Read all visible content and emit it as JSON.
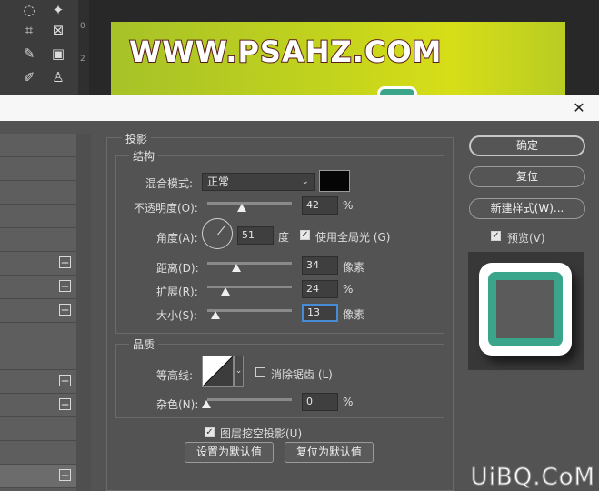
{
  "canvas": {
    "site_text": "WWW.PSAHZ.COM",
    "ruler_marks": [
      "0",
      "2"
    ]
  },
  "dialog": {
    "close_glyph": "✕",
    "section_title": "投影",
    "structure": {
      "title": "结构",
      "blend_mode_label": "混合模式:",
      "blend_mode_value": "正常",
      "shadow_color": "#050505",
      "opacity_label": "不透明度(O):",
      "opacity_value": "42",
      "opacity_unit": "%",
      "angle_label": "角度(A):",
      "angle_value": "51",
      "angle_unit": "度",
      "global_light_label": "使用全局光 (G)",
      "global_light_checked": true,
      "distance_label": "距离(D):",
      "distance_value": "34",
      "distance_unit": "像素",
      "spread_label": "扩展(R):",
      "spread_value": "24",
      "spread_unit": "%",
      "size_label": "大小(S):",
      "size_value": "13",
      "size_unit": "像素"
    },
    "quality": {
      "title": "品质",
      "contour_label": "等高线:",
      "anti_alias_label": "消除锯齿 (L)",
      "anti_alias_checked": false,
      "noise_label": "杂色(N):",
      "noise_value": "0",
      "noise_unit": "%"
    },
    "knockout_label": "图层挖空投影(U)",
    "knockout_checked": true,
    "set_default_label": "设置为默认值",
    "reset_default_label": "复位为默认值",
    "buttons": {
      "ok": "确定",
      "reset": "复位",
      "new_style": "新建样式(W)...",
      "preview_label": "预览(V)",
      "preview_checked": true
    },
    "plus_glyph": "+"
  },
  "colors": {
    "preview_teal": "#3aa58a",
    "canvas_green": "#c4d41c"
  },
  "watermark": "UiBQ.CoM"
}
